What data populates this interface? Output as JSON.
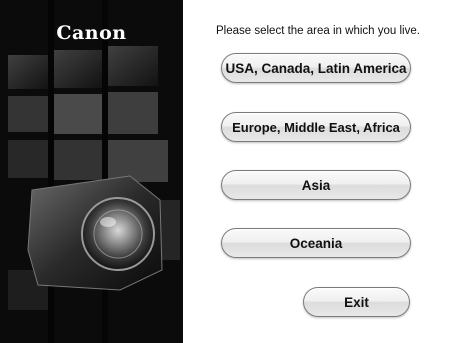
{
  "branding": {
    "logo_text": "Canon"
  },
  "dialog": {
    "prompt": "Please select the area in which you live."
  },
  "regions": [
    {
      "label": "USA, Canada, Latin America"
    },
    {
      "label": "Europe, Middle East, Africa"
    },
    {
      "label": "Asia"
    },
    {
      "label": "Oceania"
    }
  ],
  "actions": {
    "exit_label": "Exit"
  },
  "colors": {
    "left_panel_bg": "#0b0b0b",
    "button_border": "#7a7a7a",
    "text": "#111111"
  }
}
